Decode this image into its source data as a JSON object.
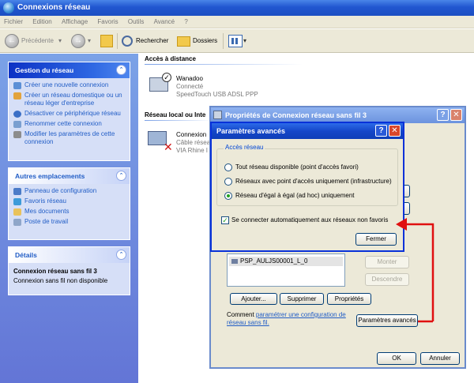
{
  "window": {
    "title": "Connexions réseau"
  },
  "menu": [
    "Fichier",
    "Edition",
    "Affichage",
    "Favoris",
    "Outils",
    "Avancé",
    "?"
  ],
  "toolbar": {
    "back": "Précédente",
    "search": "Rechercher",
    "folders": "Dossiers"
  },
  "sidebar": {
    "network_tasks": {
      "title": "Gestion du réseau",
      "items": [
        "Créer une nouvelle connexion",
        "Créer un réseau domestique ou un réseau léger d'entreprise",
        "Désactiver ce périphérique réseau",
        "Renommer cette connexion",
        "Modifier les paramètres de cette connexion"
      ]
    },
    "other_places": {
      "title": "Autres emplacements",
      "items": [
        "Panneau de configuration",
        "Favoris réseau",
        "Mes documents",
        "Poste de travail"
      ]
    },
    "details": {
      "title": "Détails",
      "name": "Connexion réseau sans fil 3",
      "status": "Connexion sans fil non disponible"
    }
  },
  "content": {
    "remote_group": "Accès à distance",
    "lan_group": "Réseau local ou Inte",
    "wanadoo": {
      "name": "Wanadoo",
      "status": "Connecté",
      "device": "SpeedTouch USB ADSL PPP"
    },
    "lan_conn": {
      "name": "Connexion",
      "status": "Câble réseau",
      "device": "VIA Rhine I"
    }
  },
  "props_dialog": {
    "title": "Propriétés de Connexion réseau sans fil 3",
    "network_item": "PSP_AULJS00001_L_0",
    "up": "Monter",
    "down": "Descendre",
    "add": "Ajouter...",
    "remove": "Supprimer",
    "properties": "Propriétés",
    "learn_prefix": "Comment ",
    "learn_link": "paramétrer une configuration de réseau sans fil.",
    "advanced": "Paramètres avancés",
    "ok": "OK",
    "cancel": "Annuler"
  },
  "adv_dialog": {
    "title": "Paramètres avancés",
    "group": "Accès réseau",
    "options": [
      "Tout réseau disponible (point d'accès favori)",
      "Réseaux avec point d'accès uniquement (infrastructure)",
      "Réseau d'égal à égal (ad hoc) uniquement"
    ],
    "selected": 2,
    "auto_connect": "Se connecter automatiquement aux réseaux non favoris",
    "close": "Fermer"
  },
  "colors": {
    "accent": "#215dc6",
    "arrow": "#e01010"
  }
}
